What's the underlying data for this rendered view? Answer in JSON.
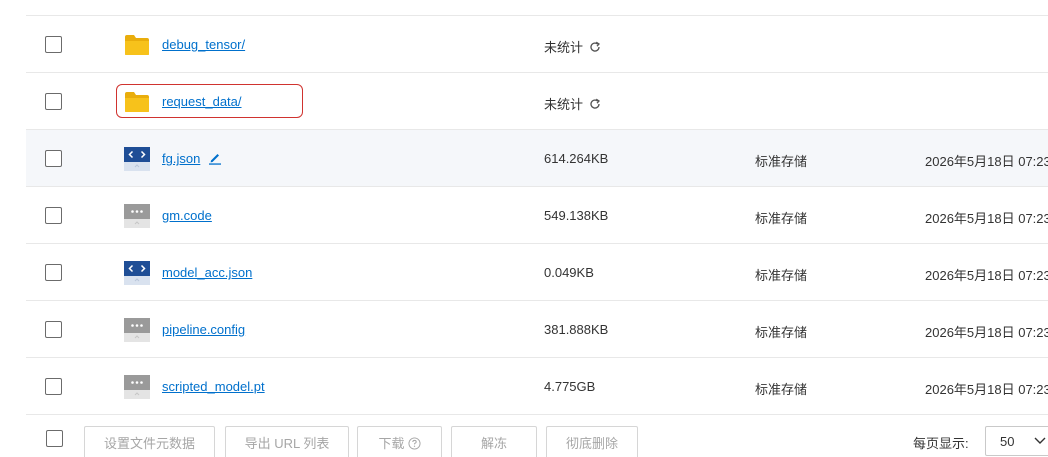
{
  "files": [
    {
      "icon": "folder-icon",
      "name": "debug_tensor/",
      "size": "未统计",
      "refresh": true,
      "storage": "",
      "date": ""
    },
    {
      "icon": "folder-icon",
      "name": "request_data/",
      "size": "未统计",
      "refresh": true,
      "storage": "",
      "date": "",
      "highlighted": true
    },
    {
      "icon": "json-file-icon",
      "name": "fg.json",
      "size": "614.264KB",
      "storage": "标准存储",
      "date": "2026年5月18日 07:23",
      "editable": true,
      "hover": true
    },
    {
      "icon": "generic-file-icon",
      "name": "gm.code",
      "size": "549.138KB",
      "storage": "标准存储",
      "date": "2026年5月18日 07:23"
    },
    {
      "icon": "json-file-icon",
      "name": "model_acc.json",
      "size": "0.049KB",
      "storage": "标准存储",
      "date": "2026年5月18日 07:23"
    },
    {
      "icon": "generic-file-icon",
      "name": "pipeline.config",
      "size": "381.888KB",
      "storage": "标准存储",
      "date": "2026年5月18日 07:23"
    },
    {
      "icon": "generic-file-icon",
      "name": "scripted_model.pt",
      "size": "4.775GB",
      "storage": "标准存储",
      "date": "2026年5月18日 07:23"
    }
  ],
  "footer": {
    "buttons": {
      "set_metadata": "设置文件元数据",
      "export_urls": "导出 URL 列表",
      "download": "下载",
      "unfreeze": "解冻",
      "delete": "彻底删除"
    },
    "per_page_label": "每页显示:",
    "per_page_value": "50"
  },
  "colors": {
    "link": "#0070cc",
    "folder": "#f7c21b",
    "json_icon": "#1f4e96",
    "generic_icon": "#9a9a9a",
    "highlight_border": "#d0332f",
    "hover_row": "#f5f7fa"
  }
}
